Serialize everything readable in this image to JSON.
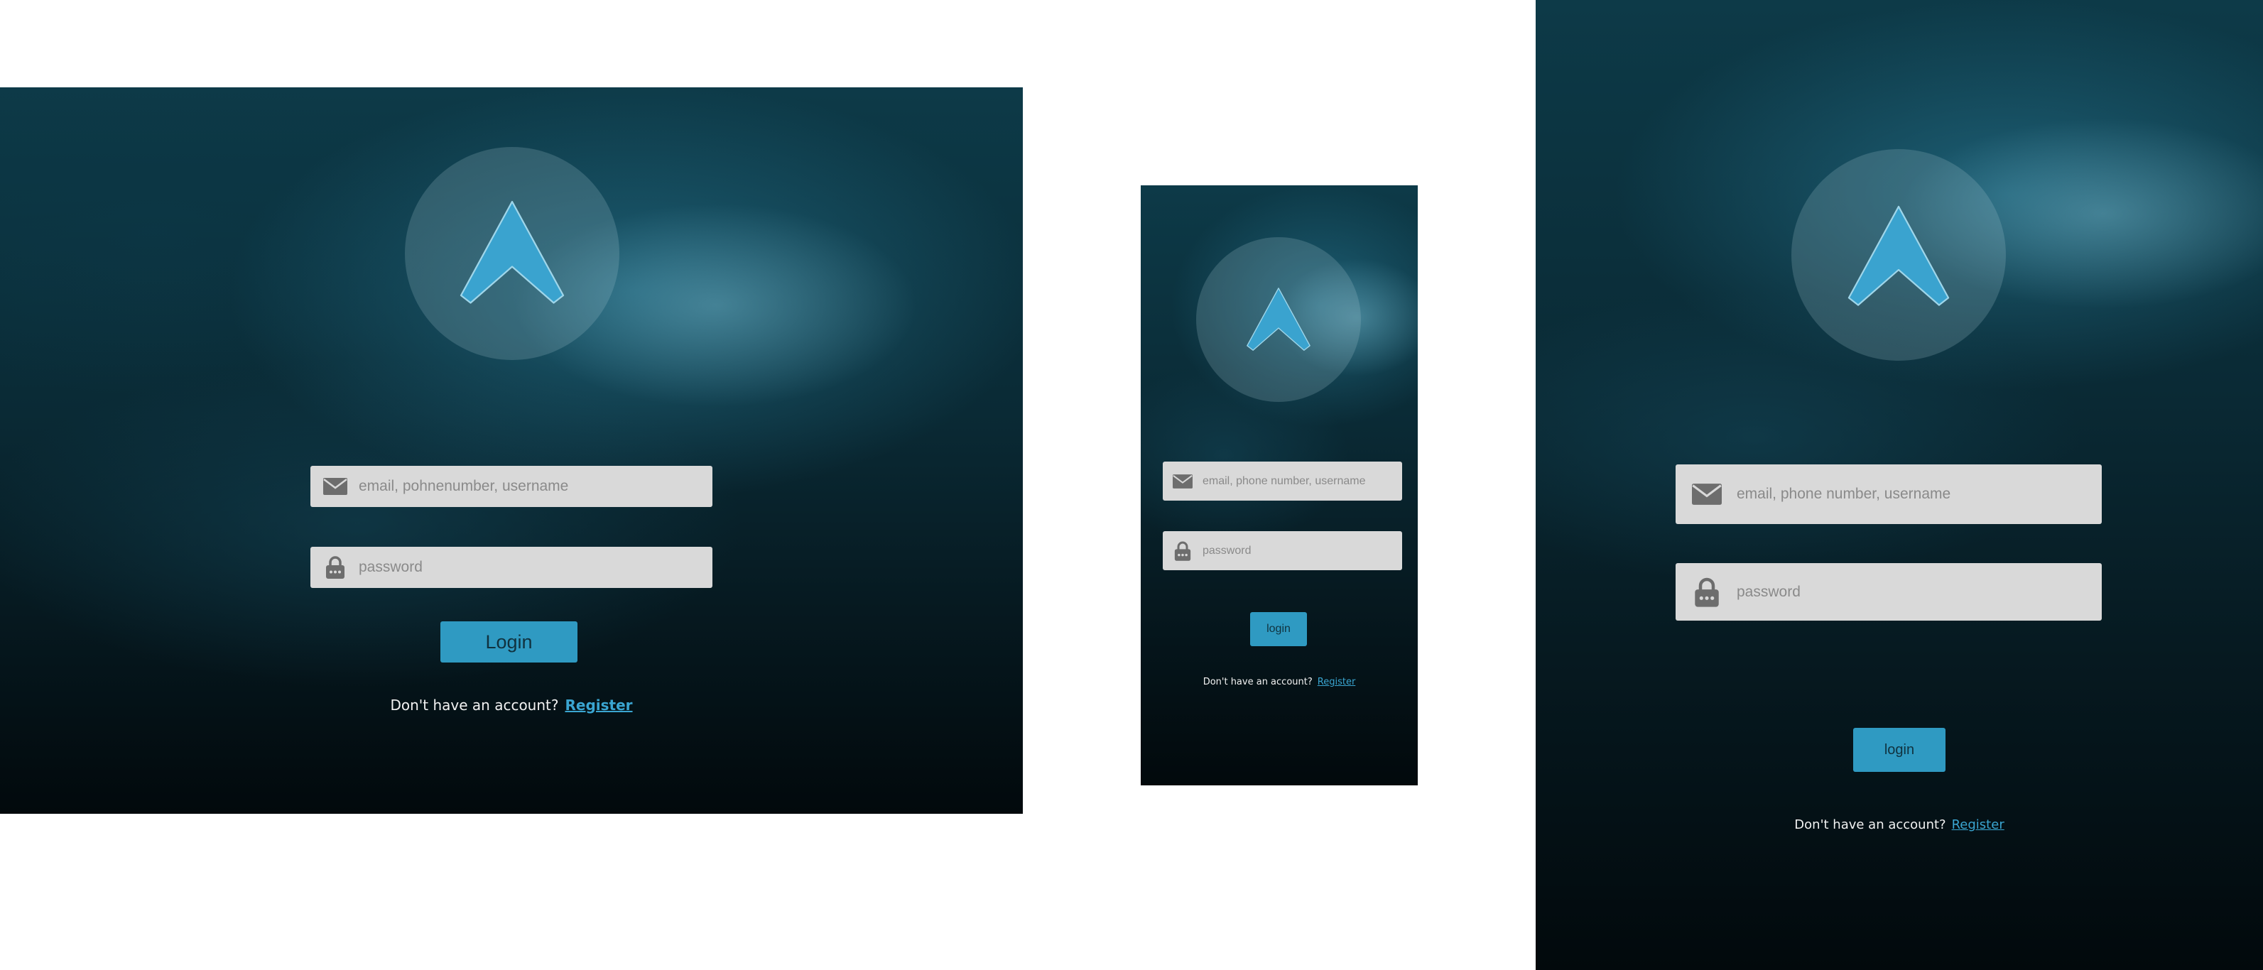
{
  "frames": {
    "desktop": {
      "email_placeholder": "email, pohnenumber, username",
      "password_placeholder": "password",
      "login_label": "Login",
      "no_account_text": "Don't have an account?",
      "register_label": "Register"
    },
    "mobile": {
      "email_placeholder": "email, phone number, username",
      "password_placeholder": "password",
      "login_label": "login",
      "no_account_text": "Don't have an account?",
      "register_label": "Register"
    },
    "tablet": {
      "email_placeholder": "email, phone number, username",
      "password_placeholder": "password",
      "login_label": "login",
      "no_account_text": "Don't have an account?",
      "register_label": "Register"
    }
  },
  "icons": {
    "logo": "apex-triangle-logo",
    "email": "envelope-icon",
    "password": "lock-icon"
  },
  "colors": {
    "accent": "#2f9ac2",
    "logo_blue": "#3aa3cf",
    "field_bg": "#d9d9d9",
    "placeholder": "#8a8a8a",
    "link": "#3aa5d1",
    "background_dark": "#061920"
  }
}
